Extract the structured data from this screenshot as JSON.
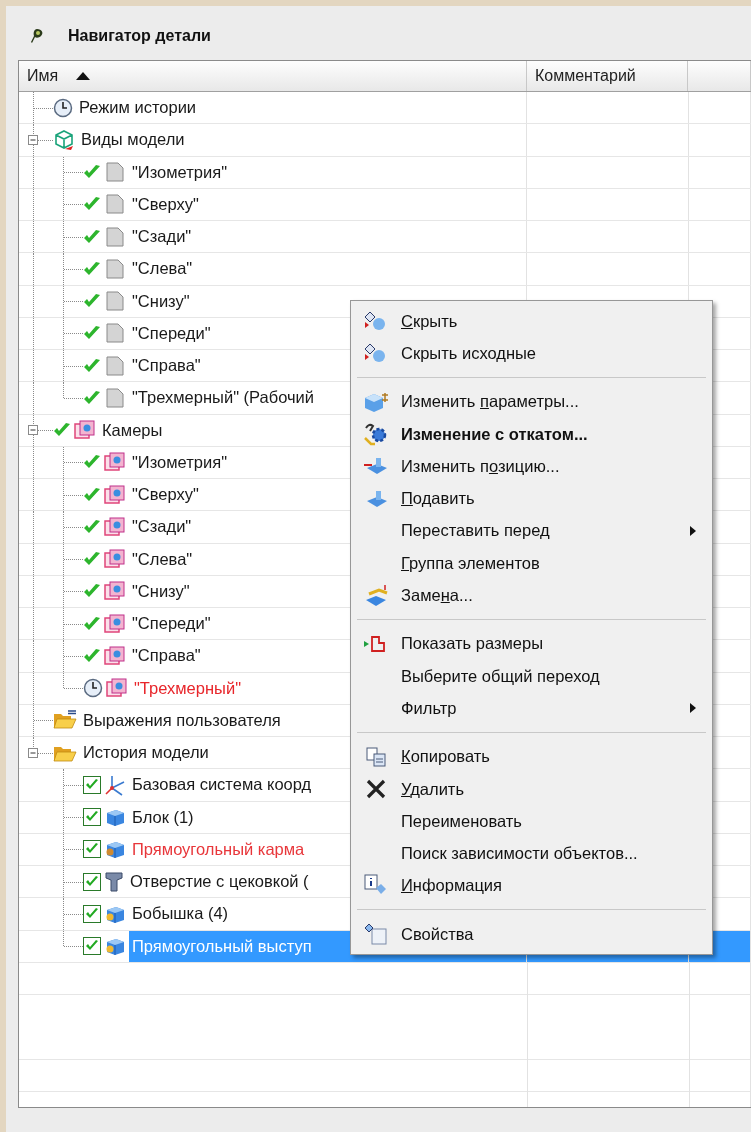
{
  "title": "Навигатор детали",
  "columns": [
    {
      "label": "Имя",
      "sorted": true
    },
    {
      "label": "Комментарий",
      "sorted": false
    }
  ],
  "tree": [
    {
      "label": "Режим истории",
      "icon": {
        "kind": "clock"
      },
      "selected": false
    },
    {
      "label": "Виды модели",
      "icon": {
        "kind": "cube"
      },
      "selected": false,
      "expanded": true,
      "children": [
        {
          "label": "\"Изометрия\"",
          "icon": {
            "kind": "sheet"
          },
          "check": {
            "kind": "tick",
            "checked": true
          },
          "selected": false
        },
        {
          "label": "\"Сверху\"",
          "icon": {
            "kind": "sheet"
          },
          "check": {
            "kind": "tick",
            "checked": true
          },
          "selected": false
        },
        {
          "label": "\"Сзади\"",
          "icon": {
            "kind": "sheet"
          },
          "check": {
            "kind": "tick",
            "checked": true
          },
          "selected": false
        },
        {
          "label": "\"Слева\"",
          "icon": {
            "kind": "sheet"
          },
          "check": {
            "kind": "tick",
            "checked": true
          },
          "selected": false
        },
        {
          "label": "\"Снизу\"",
          "icon": {
            "kind": "sheet"
          },
          "check": {
            "kind": "tick",
            "checked": true
          },
          "selected": false
        },
        {
          "label": "\"Спереди\"",
          "icon": {
            "kind": "sheet"
          },
          "check": {
            "kind": "tick",
            "checked": true
          },
          "selected": false
        },
        {
          "label": "\"Справа\"",
          "icon": {
            "kind": "sheet"
          },
          "check": {
            "kind": "tick",
            "checked": true
          },
          "selected": false
        },
        {
          "label": "\"Трехмерный\" (Рабочий",
          "icon": {
            "kind": "sheet"
          },
          "check": {
            "kind": "tick",
            "checked": true
          },
          "selected": false
        }
      ]
    },
    {
      "label": "Камеры",
      "icon": {
        "kind": "camera"
      },
      "check": {
        "kind": "tick",
        "checked": true
      },
      "selected": false,
      "expanded": true,
      "children": [
        {
          "label": "\"Изометрия\"",
          "icon": {
            "kind": "camera"
          },
          "check": {
            "kind": "tick",
            "checked": true
          },
          "selected": false
        },
        {
          "label": "\"Сверху\"",
          "icon": {
            "kind": "camera"
          },
          "check": {
            "kind": "tick",
            "checked": true
          },
          "selected": false
        },
        {
          "label": "\"Сзади\"",
          "icon": {
            "kind": "camera"
          },
          "check": {
            "kind": "tick",
            "checked": true
          },
          "selected": false
        },
        {
          "label": "\"Слева\"",
          "icon": {
            "kind": "camera"
          },
          "check": {
            "kind": "tick",
            "checked": true
          },
          "selected": false
        },
        {
          "label": "\"Снизу\"",
          "icon": {
            "kind": "camera"
          },
          "check": {
            "kind": "tick",
            "checked": true
          },
          "selected": false
        },
        {
          "label": "\"Спереди\"",
          "icon": {
            "kind": "camera"
          },
          "check": {
            "kind": "tick",
            "checked": true
          },
          "selected": false
        },
        {
          "label": "\"Справа\"",
          "icon": {
            "kind": "camera"
          },
          "check": {
            "kind": "tick",
            "checked": true
          },
          "selected": false
        },
        {
          "label": "\"Трехмерный\"",
          "icon": {
            "kind": "camera"
          },
          "check": {
            "kind": "clock"
          },
          "selected": false,
          "color": "#e8262b"
        }
      ]
    },
    {
      "label": "Выражения пользователя",
      "icon": {
        "kind": "expressions"
      },
      "selected": false
    },
    {
      "label": "История модели",
      "icon": {
        "kind": "folder"
      },
      "selected": false,
      "expanded": true,
      "children": [
        {
          "label": "Базовая система коорд",
          "icon": {
            "kind": "axes"
          },
          "check": {
            "kind": "checkbox",
            "checked": true
          },
          "selected": false
        },
        {
          "label": "Блок (1)",
          "icon": {
            "kind": "block"
          },
          "check": {
            "kind": "checkbox",
            "checked": true
          },
          "selected": false
        },
        {
          "label": "Прямоугольный карма",
          "icon": {
            "kind": "pocket"
          },
          "check": {
            "kind": "checkbox",
            "checked": true
          },
          "selected": false,
          "color": "#e8363a"
        },
        {
          "label": "Отверстие с цековкой (",
          "icon": {
            "kind": "bolt"
          },
          "check": {
            "kind": "checkbox",
            "checked": true
          },
          "selected": false
        },
        {
          "label": "Бобышка (4)",
          "icon": {
            "kind": "boss"
          },
          "check": {
            "kind": "checkbox",
            "checked": true
          },
          "selected": false
        },
        {
          "label": "Прямоугольный выступ",
          "icon": {
            "kind": "boss"
          },
          "check": {
            "kind": "checkbox",
            "checked": true
          },
          "selected": true
        }
      ]
    }
  ],
  "context_menu": {
    "items": [
      {
        "kind": "item",
        "icon": {
          "kind": "hide"
        },
        "label_parts": {
          "accel": "С",
          "after": "крыть"
        },
        "default": false,
        "submenu": false
      },
      {
        "kind": "item",
        "icon": {
          "kind": "hide"
        },
        "label": "Скрыть исходные",
        "default": false,
        "submenu": false
      },
      {
        "kind": "separator"
      },
      {
        "kind": "item",
        "icon": {
          "kind": "edit-params"
        },
        "label_parts": {
          "before": "Изменить ",
          "accel": "п",
          "after": "араметры..."
        },
        "default": false,
        "submenu": false
      },
      {
        "kind": "item",
        "icon": {
          "kind": "rollback"
        },
        "label": "Изменение с откатом...",
        "default": true,
        "submenu": false
      },
      {
        "kind": "item",
        "icon": {
          "kind": "reposition"
        },
        "label_parts": {
          "before": "Изменить п",
          "accel": "о",
          "after": "зицию..."
        },
        "default": false,
        "submenu": false
      },
      {
        "kind": "item",
        "icon": {
          "kind": "suppress"
        },
        "label_parts": {
          "accel": "П",
          "after": "одавить"
        },
        "default": false,
        "submenu": false
      },
      {
        "kind": "item",
        "label": "Переставить перед",
        "default": false,
        "submenu": true
      },
      {
        "kind": "item",
        "label_parts": {
          "accel": "Г",
          "after": "руппа элементов"
        },
        "default": false,
        "submenu": false
      },
      {
        "kind": "item",
        "icon": {
          "kind": "replace"
        },
        "label_parts": {
          "before": "Заме",
          "accel": "н",
          "after": "а..."
        },
        "default": false,
        "submenu": false
      },
      {
        "kind": "separator"
      },
      {
        "kind": "item",
        "icon": {
          "kind": "dimensions"
        },
        "label": "Показать размеры",
        "default": false,
        "submenu": false
      },
      {
        "kind": "item",
        "label": "Выберите общий переход",
        "default": false,
        "submenu": false
      },
      {
        "kind": "item",
        "label": "Фильтр",
        "default": false,
        "submenu": true
      },
      {
        "kind": "separator"
      },
      {
        "kind": "item",
        "icon": {
          "kind": "copy"
        },
        "label_parts": {
          "accel": "К",
          "after": "опировать"
        },
        "default": false,
        "submenu": false
      },
      {
        "kind": "item",
        "icon": {
          "kind": "delete"
        },
        "label_parts": {
          "accel": "У",
          "after": "далить"
        },
        "default": false,
        "submenu": false
      },
      {
        "kind": "item",
        "label": "Переименовать",
        "default": false,
        "submenu": false
      },
      {
        "kind": "item",
        "label": "Поиск зависимости объектов...",
        "default": false,
        "submenu": false
      },
      {
        "kind": "item",
        "icon": {
          "kind": "info"
        },
        "label_parts": {
          "accel": "И",
          "after": "нформация"
        },
        "default": false,
        "submenu": false
      },
      {
        "kind": "separator"
      },
      {
        "kind": "item",
        "icon": {
          "kind": "properties"
        },
        "label": "Свойства",
        "default": false,
        "submenu": false
      }
    ]
  }
}
